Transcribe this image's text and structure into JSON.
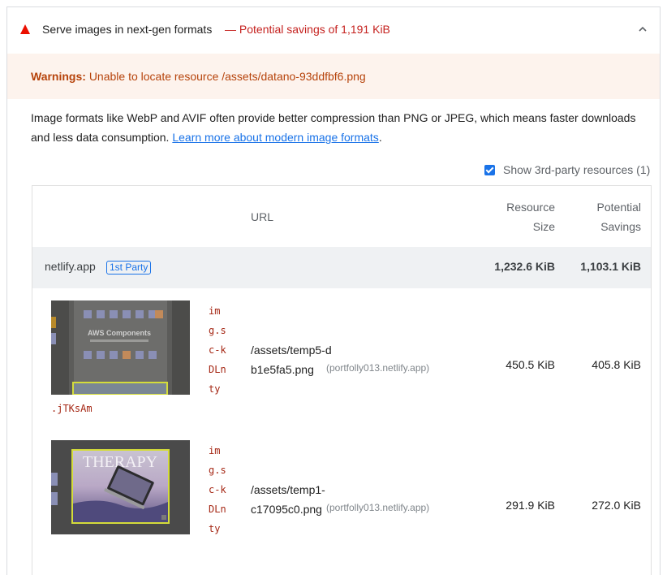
{
  "audit": {
    "title": "Serve images in next-gen formats",
    "savings": "— Potential savings of 1,191 KiB"
  },
  "warning": {
    "label": "Warnings:",
    "message": "Unable to locate resource /assets/datano-93ddfbf6.png"
  },
  "description": {
    "text": "Image formats like WebP and AVIF often provide better compression than PNG or JPEG, which means faster downloads and less data consumption. ",
    "link": "Learn more about modern image formats",
    "end": "."
  },
  "third_party": {
    "label": "Show 3rd-party resources (1)",
    "checked": true
  },
  "table": {
    "headers": {
      "url": "URL",
      "size": "Resource Size",
      "savings": "Potential Savings"
    },
    "group": {
      "name": "netlify.app",
      "badge": "1st Party",
      "size": "1,232.6 KiB",
      "savings": "1,103.1 KiB"
    },
    "rows": [
      {
        "selector": "img.sc-kDLnty",
        "selector_tail": ".jTKsAm",
        "path": "/assets/temp5-db1e5fa5.png",
        "origin": "(portfolly013.netlify.app)",
        "size": "450.5 KiB",
        "savings": "405.8 KiB",
        "thumb_text": "AWS Components"
      },
      {
        "selector": "img.sc-kDLnty",
        "path": "/assets/temp1-c17095c0.png",
        "origin": "(portfolly013.netlify.app)",
        "size": "291.9 KiB",
        "savings": "272.0 KiB",
        "thumb_text": "THERAPY"
      }
    ]
  },
  "colors": {
    "fail": "#eb0f00",
    "warning_bg": "#fdf3ed",
    "link": "#1a73e8",
    "savings": "#c5221f"
  }
}
